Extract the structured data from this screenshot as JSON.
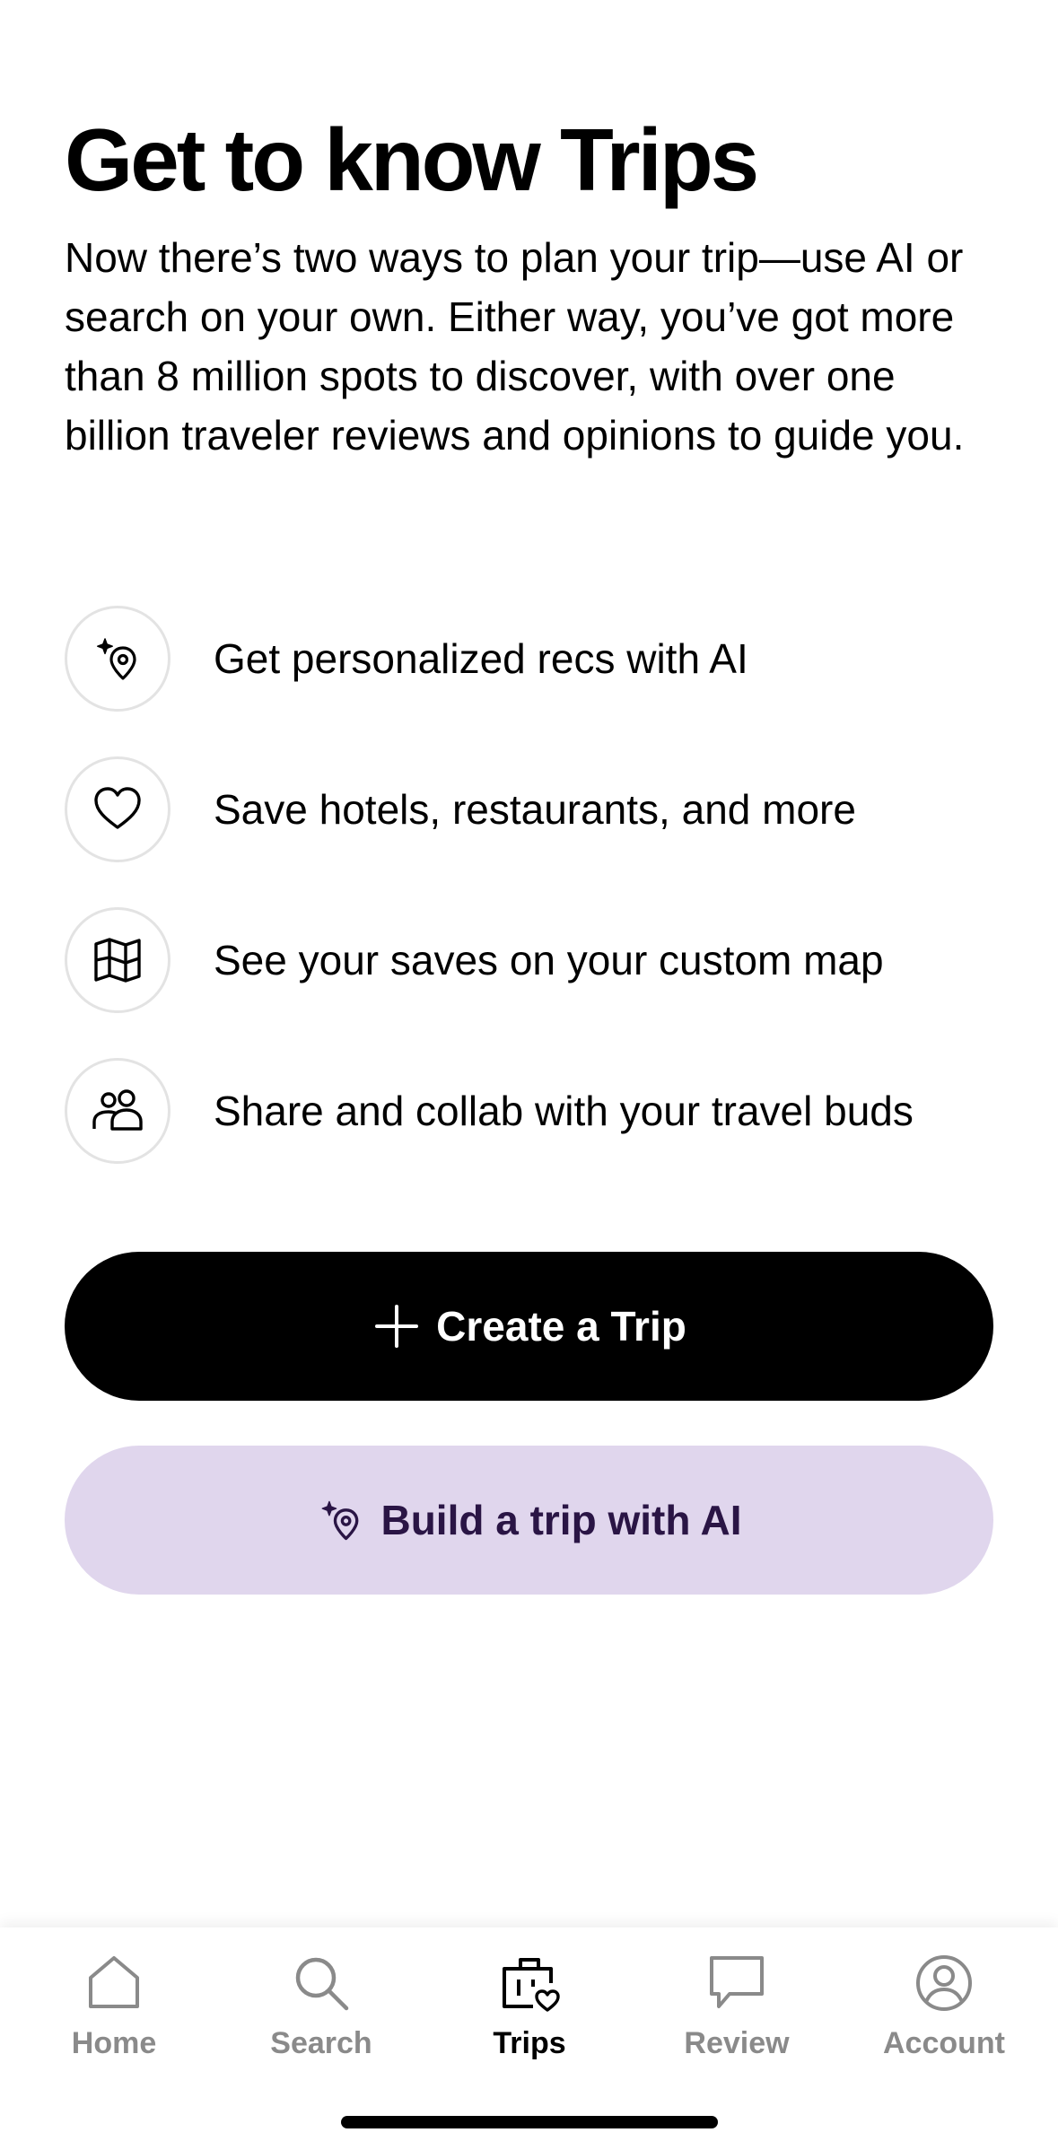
{
  "header": {
    "title": "Get to know Trips",
    "intro": "Now there’s two ways to plan your trip—use AI or search on your own. Either way, you’ve got more than 8 million spots to discover, with over one billion traveler reviews and opinions to guide you."
  },
  "features": [
    {
      "icon": "ai-location-sparkle-icon",
      "label": "Get personalized recs with AI"
    },
    {
      "icon": "heart-icon",
      "label": "Save hotels, restaurants, and more"
    },
    {
      "icon": "map-icon",
      "label": "See your saves on your custom map"
    },
    {
      "icon": "people-icon",
      "label": "Share and collab with your travel buds"
    }
  ],
  "actions": {
    "create_trip_label": "Create a Trip",
    "build_ai_label": "Build a trip with AI"
  },
  "tabbar": {
    "active": "Trips",
    "items": [
      {
        "label": "Home",
        "icon": "home-icon"
      },
      {
        "label": "Search",
        "icon": "search-icon"
      },
      {
        "label": "Trips",
        "icon": "suitcase-heart-icon"
      },
      {
        "label": "Review",
        "icon": "chat-bubble-icon"
      },
      {
        "label": "Account",
        "icon": "user-circle-icon"
      }
    ]
  },
  "colors": {
    "primary_button_bg": "#000000",
    "primary_button_text": "#ffffff",
    "ai_button_bg": "#e0d6ed",
    "ai_button_text": "#2a1545",
    "inactive_tab": "#8a8a8a",
    "active_tab": "#000000"
  }
}
